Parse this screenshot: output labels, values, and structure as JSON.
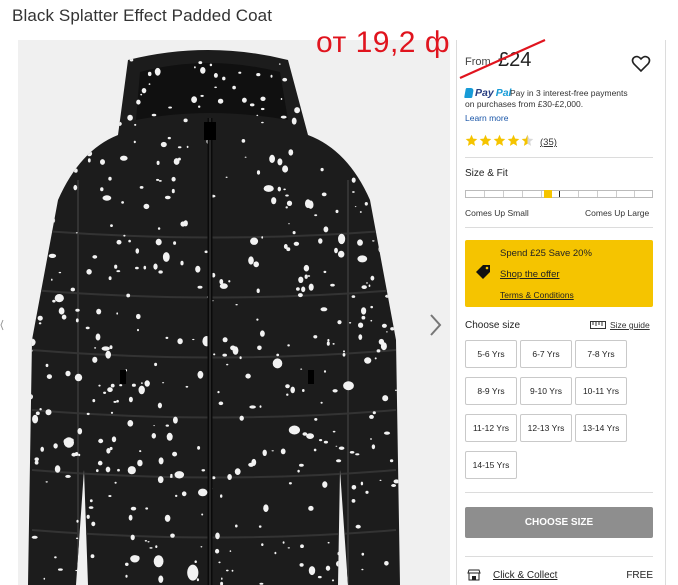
{
  "product": {
    "title": "Black Splatter Effect Padded Coat",
    "from_label": "From",
    "price": "£24",
    "overlay_price": "от 19,2 ф"
  },
  "paypal": {
    "brand_part1": "Pay",
    "brand_part2": "Pal",
    "text_line1": "Pay in 3 interest-free payments",
    "text_line2": "on purchases from £30-£2,000.",
    "learn_more": "Learn more"
  },
  "rating": {
    "stars": 4.5,
    "max": 5,
    "count": "(35)",
    "star_color": "#f5c400"
  },
  "fit": {
    "title": "Size & Fit",
    "left_label": "Comes Up Small",
    "right_label": "Comes Up Large",
    "position_pct": 50
  },
  "offer": {
    "title": "Spend £25 Save 20%",
    "shop_link": "Shop the offer",
    "terms_link": "Terms & Conditions",
    "bg_color": "#f5c400"
  },
  "sizes": {
    "label": "Choose size",
    "guide_label": "Size guide",
    "options": [
      "5-6 Yrs",
      "6-7 Yrs",
      "7-8 Yrs",
      "8-9 Yrs",
      "9-10 Yrs",
      "10-11 Yrs",
      "11-12 Yrs",
      "12-13 Yrs",
      "13-14 Yrs",
      "14-15 Yrs"
    ]
  },
  "actions": {
    "choose_size": "CHOOSE SIZE",
    "click_collect": "Click & Collect",
    "free": "FREE"
  },
  "icons": {
    "wishlist": "heart-icon",
    "next": "chevron-right-icon",
    "offer": "price-tag-icon",
    "size_guide": "ruler-icon"
  },
  "colors": {
    "overlay_red": "#e0141e",
    "paypal_dark": "#253b80",
    "paypal_light": "#179bd7",
    "button_grey": "#8e8e8e"
  }
}
